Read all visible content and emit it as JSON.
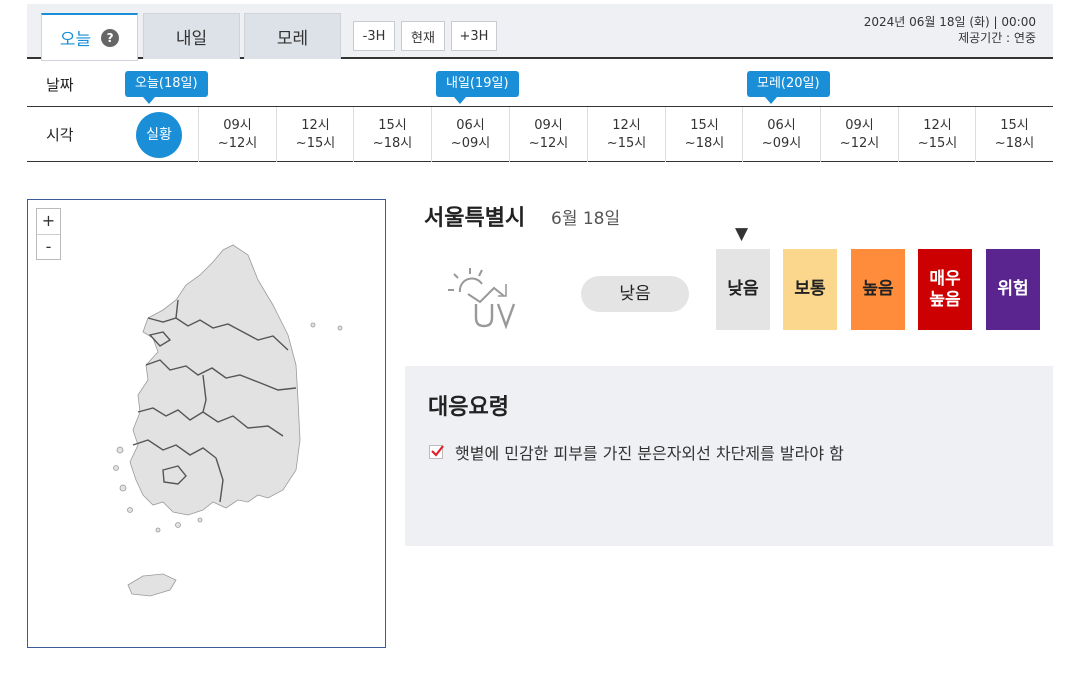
{
  "tabs": [
    {
      "label": "오늘",
      "active": true
    },
    {
      "label": "내일",
      "active": false
    },
    {
      "label": "모레",
      "active": false
    }
  ],
  "help_icon": "?",
  "time_buttons": [
    "-3H",
    "현재",
    "+3H"
  ],
  "date_info": {
    "line1": "2024년 06월 18일 (화) | 00:00",
    "line2": "제공기간 : 연중"
  },
  "timeline": {
    "date_label": "날짜",
    "time_label": "시각",
    "days": [
      "오늘(18일)",
      "내일(19일)",
      "모레(20일)"
    ],
    "now_label": "실황",
    "slots": [
      {
        "a": "09시",
        "b": "~12시"
      },
      {
        "a": "12시",
        "b": "~15시"
      },
      {
        "a": "15시",
        "b": "~18시"
      },
      {
        "a": "06시",
        "b": "~09시"
      },
      {
        "a": "09시",
        "b": "~12시"
      },
      {
        "a": "12시",
        "b": "~15시"
      },
      {
        "a": "15시",
        "b": "~18시"
      },
      {
        "a": "06시",
        "b": "~09시"
      },
      {
        "a": "09시",
        "b": "~12시"
      },
      {
        "a": "12시",
        "b": "~15시"
      },
      {
        "a": "15시",
        "b": "~18시"
      }
    ]
  },
  "map": {
    "zoom_in": "+",
    "zoom_out": "-"
  },
  "location": {
    "city": "서울특별시",
    "date": "6월 18일"
  },
  "uv": {
    "icon": "uv-sun-icon",
    "current_level": "낮음",
    "marker": "▼",
    "scale": [
      {
        "label": "낮음",
        "color": "#e4e4e4",
        "text_color": "#222"
      },
      {
        "label": "보통",
        "color": "#fbd78e",
        "text_color": "#222"
      },
      {
        "label": "높음",
        "color": "#ff8c3a",
        "text_color": "#222"
      },
      {
        "label": "매우\n높음",
        "color": "#cc0000",
        "text_color": "#fff"
      },
      {
        "label": "위험",
        "color": "#5b2590",
        "text_color": "#fff"
      }
    ]
  },
  "guide": {
    "title": "대응요령",
    "items": [
      "햇볕에 민감한 피부를 가진 분은자외선 차단제를 발라야 함"
    ]
  }
}
